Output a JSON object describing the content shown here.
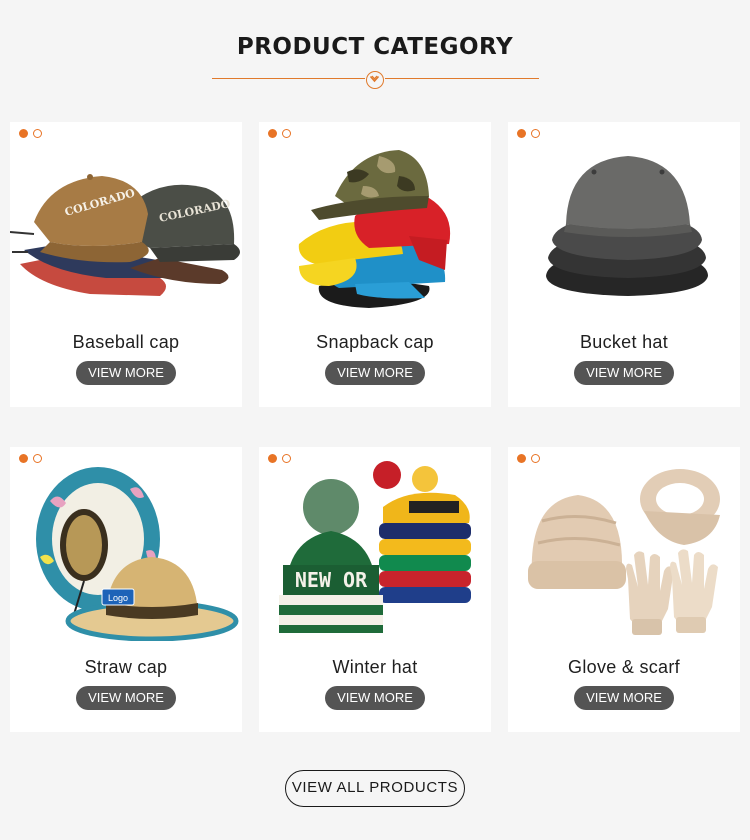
{
  "page": {
    "title": "PRODUCT CATEGORY",
    "accent_color": "#e87426",
    "button_color": "#545454",
    "view_all_label": "VIEW ALL PRODUCTS"
  },
  "categories": [
    {
      "name": "Baseball cap",
      "button": "VIEW MORE",
      "image_text": "COLORADO"
    },
    {
      "name": "Snapback cap",
      "button": "VIEW MORE"
    },
    {
      "name": "Bucket hat",
      "button": "VIEW MORE"
    },
    {
      "name": "Straw cap",
      "button": "VIEW MORE",
      "image_text": "Logo"
    },
    {
      "name": "Winter hat",
      "button": "VIEW MORE",
      "image_text": "NEW OR"
    },
    {
      "name": "Glove & scarf",
      "button": "VIEW MORE"
    }
  ]
}
